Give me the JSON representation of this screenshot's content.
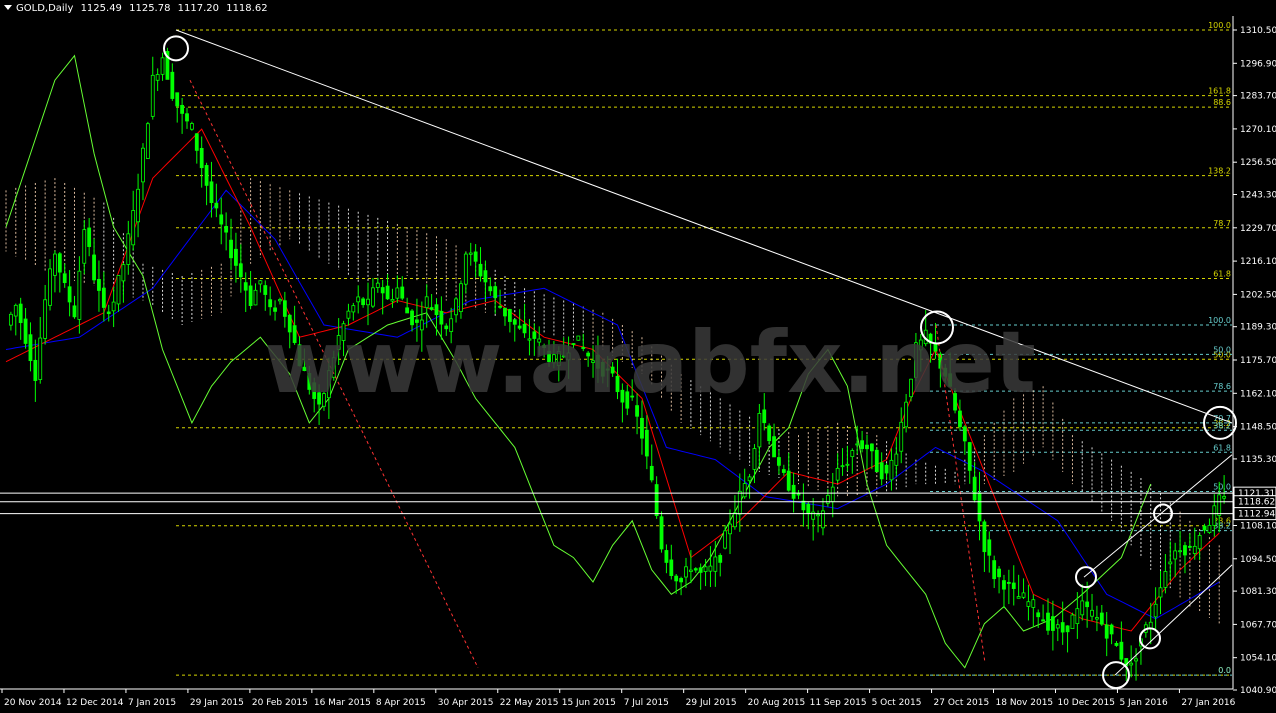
{
  "header": {
    "symbol": "GOLD,Daily",
    "open": "1125.49",
    "high": "1125.78",
    "low": "1117.20",
    "close": "1118.62"
  },
  "watermark": "www.arabfx.net",
  "colors": {
    "background": "#000000",
    "candles": "#00ff00",
    "kijun": "#0000ff",
    "tenkan": "#ff0000",
    "chikou": "#66ff33",
    "kumo_bull": "#ffdab9",
    "kumo_bear": "#ffffff",
    "fib_yellow": "#d6d600",
    "fib_cyan": "#66cccc",
    "trendline": "#ffffff",
    "red_dash": "#ff3333",
    "axis": "#ffffff"
  },
  "chart_data": {
    "type": "candlestick",
    "ylim": [
      1040.9,
      1310.5
    ],
    "y_ticks": [
      "1310.50",
      "1296.90",
      "1283.70",
      "1270.10",
      "1256.50",
      "1243.30",
      "1229.70",
      "1216.10",
      "1202.50",
      "1189.30",
      "1175.70",
      "1162.10",
      "1148.50",
      "1135.30",
      "1121.70",
      "1108.10",
      "1094.50",
      "1081.30",
      "1067.70",
      "1054.10",
      "1040.90"
    ],
    "x_ticks": [
      "20 Nov 2014",
      "12 Dec 2014",
      "7 Jan 2015",
      "29 Jan 2015",
      "20 Feb 2015",
      "16 Mar 2015",
      "8 Apr 2015",
      "30 Apr 2015",
      "22 May 2015",
      "15 Jun 2015",
      "7 Jul 2015",
      "29 Jul 2015",
      "20 Aug 2015",
      "11 Sep 2015",
      "5 Oct 2015",
      "27 Oct 2015",
      "18 Nov 2015",
      "10 Dec 2015",
      "5 Jan 2016",
      "27 Jan 2016"
    ],
    "price_tags": [
      {
        "label": "1121.31",
        "value": 1121.31
      },
      {
        "label": "1118.62",
        "value": 1118.62
      },
      {
        "label": "1112.94",
        "value": 1112.94
      }
    ],
    "close_path": [
      [
        0,
        1190
      ],
      [
        2,
        1198
      ],
      [
        4,
        1185
      ],
      [
        6,
        1170
      ],
      [
        8,
        1200
      ],
      [
        10,
        1220
      ],
      [
        12,
        1205
      ],
      [
        14,
        1195
      ],
      [
        16,
        1230
      ],
      [
        18,
        1210
      ],
      [
        20,
        1195
      ],
      [
        22,
        1200
      ],
      [
        24,
        1215
      ],
      [
        26,
        1235
      ],
      [
        28,
        1260
      ],
      [
        30,
        1290
      ],
      [
        32,
        1300
      ],
      [
        34,
        1285
      ],
      [
        36,
        1275
      ],
      [
        38,
        1270
      ],
      [
        40,
        1255
      ],
      [
        42,
        1240
      ],
      [
        44,
        1230
      ],
      [
        46,
        1220
      ],
      [
        48,
        1210
      ],
      [
        50,
        1200
      ],
      [
        52,
        1208
      ],
      [
        54,
        1195
      ],
      [
        56,
        1200
      ],
      [
        58,
        1190
      ],
      [
        60,
        1175
      ],
      [
        62,
        1165
      ],
      [
        64,
        1155
      ],
      [
        66,
        1170
      ],
      [
        68,
        1185
      ],
      [
        70,
        1195
      ],
      [
        72,
        1200
      ],
      [
        74,
        1198
      ],
      [
        76,
        1208
      ],
      [
        78,
        1200
      ],
      [
        80,
        1205
      ],
      [
        82,
        1195
      ],
      [
        84,
        1190
      ],
      [
        86,
        1200
      ],
      [
        88,
        1195
      ],
      [
        90,
        1190
      ],
      [
        92,
        1198
      ],
      [
        94,
        1220
      ],
      [
        96,
        1215
      ],
      [
        98,
        1208
      ],
      [
        100,
        1200
      ],
      [
        102,
        1195
      ],
      [
        104,
        1190
      ],
      [
        106,
        1185
      ],
      [
        108,
        1185
      ],
      [
        110,
        1180
      ],
      [
        112,
        1175
      ],
      [
        114,
        1178
      ],
      [
        116,
        1185
      ],
      [
        118,
        1180
      ],
      [
        120,
        1175
      ],
      [
        122,
        1172
      ],
      [
        124,
        1168
      ],
      [
        126,
        1160
      ],
      [
        128,
        1158
      ],
      [
        130,
        1145
      ],
      [
        132,
        1125
      ],
      [
        134,
        1100
      ],
      [
        136,
        1090
      ],
      [
        138,
        1085
      ],
      [
        140,
        1092
      ],
      [
        142,
        1088
      ],
      [
        144,
        1090
      ],
      [
        146,
        1096
      ],
      [
        148,
        1110
      ],
      [
        150,
        1120
      ],
      [
        152,
        1130
      ],
      [
        154,
        1155
      ],
      [
        156,
        1145
      ],
      [
        158,
        1130
      ],
      [
        160,
        1125
      ],
      [
        162,
        1118
      ],
      [
        164,
        1112
      ],
      [
        166,
        1110
      ],
      [
        168,
        1120
      ],
      [
        170,
        1130
      ],
      [
        172,
        1135
      ],
      [
        174,
        1142
      ],
      [
        176,
        1140
      ],
      [
        178,
        1132
      ],
      [
        180,
        1128
      ],
      [
        182,
        1140
      ],
      [
        184,
        1160
      ],
      [
        186,
        1180
      ],
      [
        188,
        1185
      ],
      [
        190,
        1178
      ],
      [
        192,
        1170
      ],
      [
        194,
        1155
      ],
      [
        196,
        1140
      ],
      [
        198,
        1120
      ],
      [
        200,
        1100
      ],
      [
        202,
        1088
      ],
      [
        204,
        1085
      ],
      [
        206,
        1080
      ],
      [
        208,
        1078
      ],
      [
        210,
        1075
      ],
      [
        212,
        1070
      ],
      [
        214,
        1066
      ],
      [
        216,
        1065
      ],
      [
        218,
        1070
      ],
      [
        220,
        1075
      ],
      [
        222,
        1072
      ],
      [
        224,
        1068
      ],
      [
        226,
        1062
      ],
      [
        228,
        1055
      ],
      [
        230,
        1050
      ],
      [
        232,
        1062
      ],
      [
        234,
        1070
      ],
      [
        236,
        1085
      ],
      [
        238,
        1095
      ],
      [
        240,
        1100
      ],
      [
        242,
        1098
      ],
      [
        244,
        1105
      ],
      [
        246,
        1110
      ],
      [
        248,
        1118
      ]
    ],
    "ichimoku": {
      "tenkan": [
        [
          0,
          1175
        ],
        [
          20,
          1195
        ],
        [
          30,
          1250
        ],
        [
          40,
          1270
        ],
        [
          50,
          1230
        ],
        [
          60,
          1185
        ],
        [
          70,
          1190
        ],
        [
          80,
          1200
        ],
        [
          90,
          1195
        ],
        [
          100,
          1200
        ],
        [
          110,
          1185
        ],
        [
          120,
          1180
        ],
        [
          130,
          1160
        ],
        [
          140,
          1095
        ],
        [
          150,
          1110
        ],
        [
          160,
          1130
        ],
        [
          170,
          1125
        ],
        [
          180,
          1135
        ],
        [
          185,
          1160
        ],
        [
          190,
          1180
        ],
        [
          200,
          1130
        ],
        [
          210,
          1080
        ],
        [
          220,
          1070
        ],
        [
          230,
          1065
        ],
        [
          240,
          1090
        ],
        [
          248,
          1105
        ]
      ],
      "kijun": [
        [
          0,
          1180
        ],
        [
          15,
          1185
        ],
        [
          30,
          1205
        ],
        [
          45,
          1245
        ],
        [
          55,
          1225
        ],
        [
          65,
          1190
        ],
        [
          80,
          1185
        ],
        [
          95,
          1200
        ],
        [
          110,
          1205
        ],
        [
          125,
          1190
        ],
        [
          135,
          1140
        ],
        [
          145,
          1135
        ],
        [
          155,
          1120
        ],
        [
          170,
          1115
        ],
        [
          180,
          1125
        ],
        [
          190,
          1140
        ],
        [
          200,
          1130
        ],
        [
          215,
          1110
        ],
        [
          225,
          1080
        ],
        [
          235,
          1070
        ],
        [
          248,
          1085
        ]
      ],
      "chikou": [
        [
          0,
          1230
        ],
        [
          10,
          1290
        ],
        [
          14,
          1300
        ],
        [
          18,
          1260
        ],
        [
          22,
          1230
        ],
        [
          28,
          1210
        ],
        [
          32,
          1180
        ],
        [
          38,
          1150
        ],
        [
          42,
          1165
        ],
        [
          46,
          1175
        ],
        [
          52,
          1185
        ],
        [
          58,
          1170
        ],
        [
          62,
          1150
        ],
        [
          66,
          1160
        ],
        [
          70,
          1180
        ],
        [
          78,
          1190
        ],
        [
          86,
          1195
        ],
        [
          92,
          1175
        ],
        [
          96,
          1160
        ],
        [
          100,
          1150
        ],
        [
          104,
          1140
        ],
        [
          108,
          1120
        ],
        [
          112,
          1100
        ],
        [
          116,
          1095
        ],
        [
          120,
          1085
        ],
        [
          124,
          1100
        ],
        [
          128,
          1110
        ],
        [
          132,
          1090
        ],
        [
          136,
          1080
        ],
        [
          140,
          1085
        ],
        [
          144,
          1095
        ],
        [
          148,
          1110
        ],
        [
          152,
          1125
        ],
        [
          156,
          1140
        ],
        [
          160,
          1148
        ],
        [
          164,
          1170
        ],
        [
          168,
          1180
        ],
        [
          172,
          1165
        ],
        [
          176,
          1125
        ],
        [
          180,
          1100
        ],
        [
          184,
          1090
        ],
        [
          188,
          1080
        ],
        [
          192,
          1060
        ],
        [
          196,
          1050
        ],
        [
          200,
          1068
        ],
        [
          204,
          1075
        ],
        [
          208,
          1065
        ],
        [
          214,
          1070
        ],
        [
          220,
          1080
        ],
        [
          228,
          1095
        ],
        [
          234,
          1125
        ]
      ],
      "cloud": [
        [
          0,
          1245,
          1220
        ],
        [
          10,
          1250,
          1210
        ],
        [
          20,
          1240,
          1205
        ],
        [
          28,
          1215,
          1200
        ],
        [
          36,
          1210,
          1190
        ],
        [
          44,
          1215,
          1195
        ],
        [
          50,
          1250,
          1215
        ],
        [
          58,
          1245,
          1225
        ],
        [
          66,
          1240,
          1215
        ],
        [
          74,
          1235,
          1205
        ],
        [
          82,
          1230,
          1210
        ],
        [
          90,
          1225,
          1200
        ],
        [
          98,
          1215,
          1195
        ],
        [
          106,
          1205,
          1188
        ],
        [
          114,
          1200,
          1185
        ],
        [
          122,
          1195,
          1180
        ],
        [
          130,
          1185,
          1170
        ],
        [
          138,
          1170,
          1150
        ],
        [
          146,
          1160,
          1140
        ],
        [
          154,
          1150,
          1130
        ],
        [
          162,
          1145,
          1125
        ],
        [
          170,
          1150,
          1120
        ],
        [
          178,
          1145,
          1120
        ],
        [
          186,
          1135,
          1125
        ],
        [
          194,
          1130,
          1125
        ],
        [
          200,
          1145,
          1125
        ],
        [
          206,
          1160,
          1130
        ],
        [
          212,
          1165,
          1140
        ],
        [
          218,
          1145,
          1125
        ],
        [
          226,
          1135,
          1110
        ],
        [
          234,
          1125,
          1090
        ],
        [
          242,
          1110,
          1075
        ],
        [
          248,
          1100,
          1068
        ]
      ]
    },
    "fibonacci_left": {
      "levels": [
        "100.0",
        "161.8",
        "88.6",
        "138.2",
        "78.7",
        "61.8",
        "50.0",
        "38.2",
        "23.6",
        "0.0"
      ]
    },
    "fibonacci_right": {
      "levels": [
        "100.0",
        "50.0",
        "78.6",
        "70.7",
        "38.2",
        "61.8",
        "50.0",
        "38.2",
        "0.0"
      ]
    }
  }
}
